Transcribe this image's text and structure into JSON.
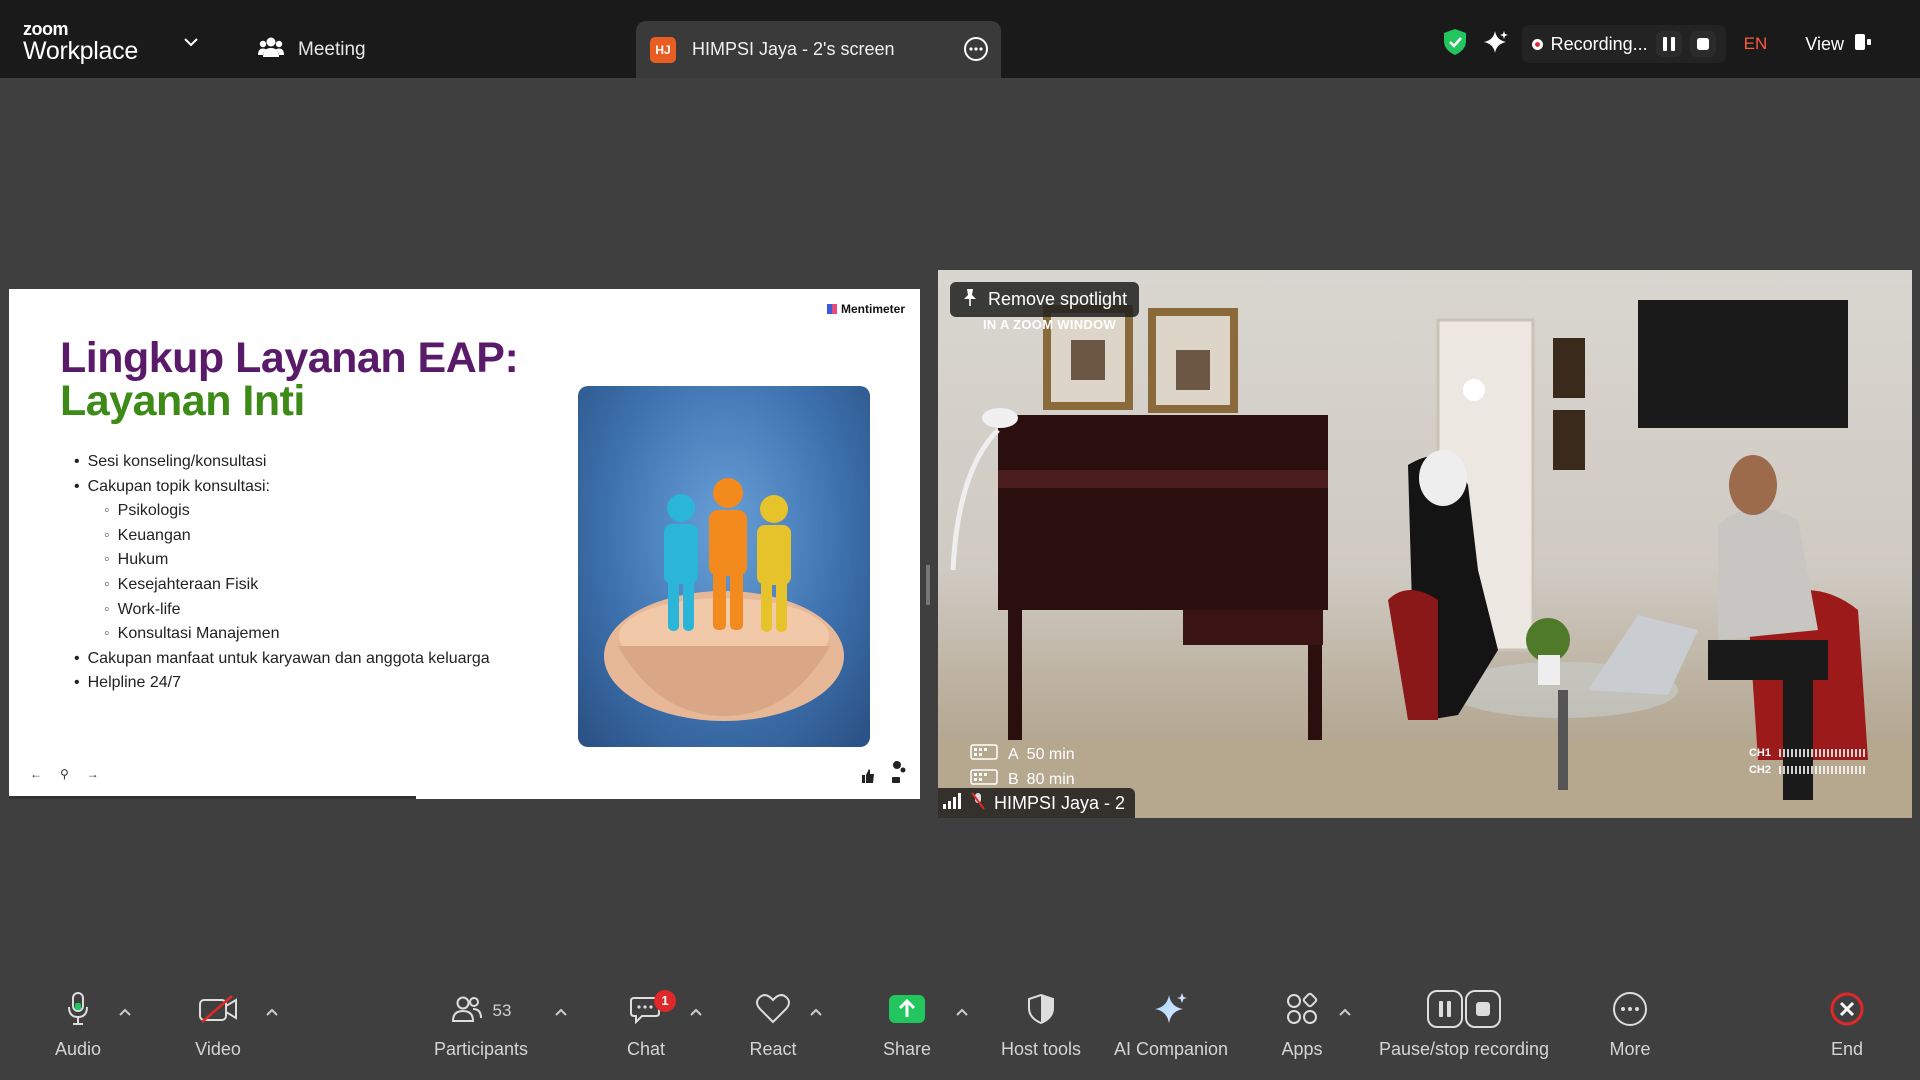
{
  "app": {
    "logo_top": "zoom",
    "logo_bottom": "Workplace",
    "meeting_label": "Meeting",
    "share_tab": {
      "initials": "HJ",
      "label": "HIMPSI Jaya - 2's screen"
    },
    "recording_text": "Recording...",
    "language": "EN",
    "view_label": "View"
  },
  "slide": {
    "brand": "Mentimeter",
    "title": "Lingkup Layanan EAP:",
    "subtitle": "Layanan Inti",
    "bullets": [
      {
        "level": 1,
        "text": "Sesi konseling/konsultasi"
      },
      {
        "level": 1,
        "text": "Cakupan topik konsultasi:"
      },
      {
        "level": 2,
        "text": "Psikologis"
      },
      {
        "level": 2,
        "text": "Keuangan"
      },
      {
        "level": 2,
        "text": "Hukum"
      },
      {
        "level": 2,
        "text": "Kesejahteraan Fisik"
      },
      {
        "level": 2,
        "text": "Work-life"
      },
      {
        "level": 2,
        "text": "Konsultasi Manajemen"
      },
      {
        "level": 1,
        "text": "Cakupan manfaat untuk karyawan dan anggota keluarga"
      },
      {
        "level": 1,
        "text": "Helpline 24/7"
      }
    ]
  },
  "video": {
    "spotlight_button": "Remove spotlight",
    "overlay_caption": "IN A ZOOM WINDOW",
    "track_a": {
      "letter": "A",
      "value": "50 min"
    },
    "track_b": {
      "letter": "B",
      "value": "80 min"
    },
    "ch1": "CH1",
    "ch2": "CH2",
    "participant_name": "HIMPSI Jaya - 2"
  },
  "toolbar": {
    "audio": "Audio",
    "video": "Video",
    "participants": "Participants",
    "participants_count": "53",
    "chat": "Chat",
    "chat_badge": "1",
    "react": "React",
    "share": "Share",
    "host_tools": "Host tools",
    "ai_companion": "AI Companion",
    "apps": "Apps",
    "pause_stop": "Pause/stop recording",
    "more": "More",
    "end": "End"
  },
  "colors": {
    "topbar_bg": "#1a1a1a",
    "stage_bg": "#3f3f3f",
    "title_purple": "#5a1a6a",
    "subtitle_green": "#3d8a17",
    "share_green": "#22c55e",
    "end_red": "#e02828",
    "lang_orange": "#ff5a3d"
  }
}
